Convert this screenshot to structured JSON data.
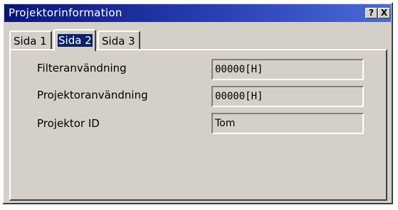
{
  "window": {
    "title": "Projektorinformation",
    "help_button": "?",
    "close_button": "X"
  },
  "tabs": [
    {
      "label": "Sida 1",
      "selected": false
    },
    {
      "label": "Sida 2",
      "selected": true
    },
    {
      "label": "Sida 3",
      "selected": false
    }
  ],
  "info": {
    "filter_label": "Filteranvändning",
    "filter_value": "00000[H]",
    "projector_usage_label": "Projektoranvändning",
    "projector_usage_value": "00000[H]",
    "projector_id_label": "Projektor ID",
    "projector_id_value": "Tom"
  },
  "colors": {
    "titlebar_start": "#08157a",
    "titlebar_end": "#4a6bd6",
    "dialog_bg": "#d4d0c8",
    "selection": "#0a246a"
  }
}
